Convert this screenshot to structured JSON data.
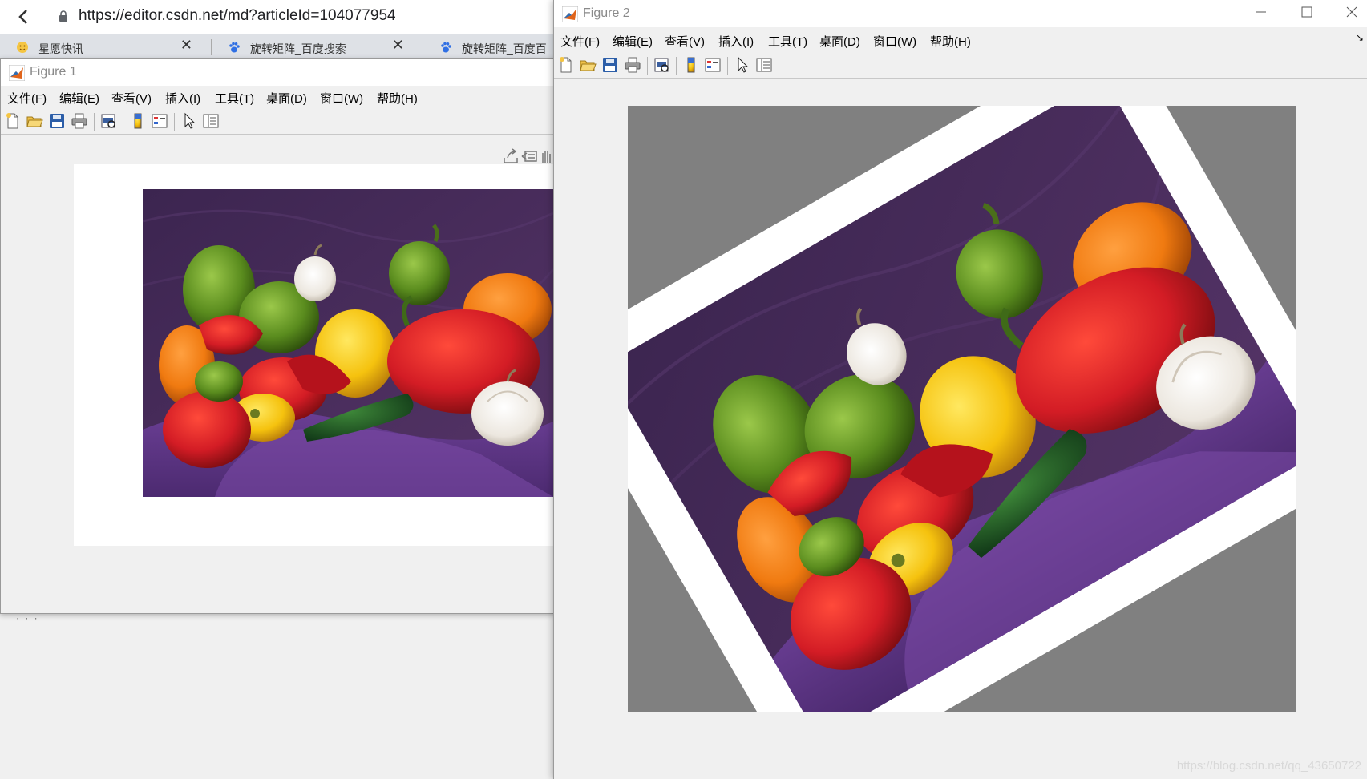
{
  "browser": {
    "url": "https://editor.csdn.net/md?articleId=104077954",
    "tabs": [
      {
        "label": "星愿快讯",
        "icon": "star-smiley-icon"
      },
      {
        "label": "旋转矩阵_百度搜索",
        "icon": "baidu-paw-icon"
      },
      {
        "label": "旋转矩阵_百度百",
        "icon": "baidu-paw-icon"
      }
    ],
    "close_symbol": "✕"
  },
  "figure1": {
    "title": "Figure 1",
    "menu": [
      "文件(F)",
      "编辑(E)",
      "查看(V)",
      "插入(I)",
      "工具(T)",
      "桌面(D)",
      "窗口(W)",
      "帮助(H)"
    ]
  },
  "figure2": {
    "title": "Figure 2",
    "menu": [
      "文件(F)",
      "编辑(E)",
      "查看(V)",
      "插入(I)",
      "工具(T)",
      "桌面(D)",
      "窗口(W)",
      "帮助(H)"
    ],
    "rotation_degrees": 30,
    "background_color": "#808080"
  },
  "toolbar_icons": [
    "new-file-icon",
    "open-folder-icon",
    "save-icon",
    "print-icon",
    "print-preview-icon",
    "colorbar-icon",
    "legend-icon",
    "pointer-icon",
    "property-inspector-icon"
  ],
  "colors": {
    "purple_backdrop": "#4a2d5e",
    "purple_cloth": "#6b3f95",
    "pepper_red": "#d31c25",
    "pepper_yellow": "#f5c20e",
    "pepper_orange": "#f07a10",
    "pepper_green": "#5a8c1e",
    "garlic": "#f2efe9",
    "figure_gray": "#808080"
  },
  "watermark": "https://blog.csdn.net/qq_43650722"
}
